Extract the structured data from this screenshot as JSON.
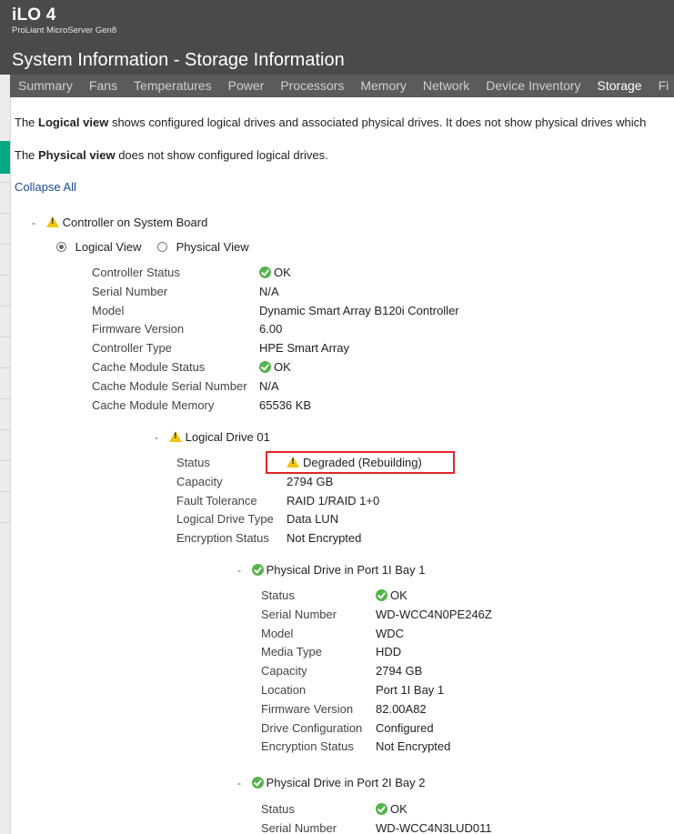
{
  "header": {
    "brand": "iLO 4",
    "server_name": "ProLiant MicroServer Gen8",
    "page_title": "System Information - Storage Information"
  },
  "tabs": [
    {
      "label": "Summary",
      "active": false
    },
    {
      "label": "Fans",
      "active": false
    },
    {
      "label": "Temperatures",
      "active": false
    },
    {
      "label": "Power",
      "active": false
    },
    {
      "label": "Processors",
      "active": false
    },
    {
      "label": "Memory",
      "active": false
    },
    {
      "label": "Network",
      "active": false
    },
    {
      "label": "Device Inventory",
      "active": false
    },
    {
      "label": "Storage",
      "active": true
    },
    {
      "label": "Fi",
      "active": false
    }
  ],
  "intro": {
    "logical_bold": "Logical view",
    "logical_rest": " shows configured logical drives and associated physical drives. It does not show physical drives which",
    "the1": "The ",
    "the2": "The ",
    "physical_bold": "Physical view",
    "physical_rest": " does not show configured logical drives."
  },
  "collapse_all": "Collapse All",
  "controller": {
    "toggle": "-",
    "title": "Controller on System Board",
    "view_logical": "Logical View",
    "view_physical": "Physical View",
    "props": [
      {
        "label": "Controller Status",
        "value": "OK",
        "icon": "ok-icon"
      },
      {
        "label": "Serial Number",
        "value": "N/A"
      },
      {
        "label": "Model",
        "value": "Dynamic Smart Array B120i Controller"
      },
      {
        "label": "Firmware Version",
        "value": "6.00"
      },
      {
        "label": "Controller Type",
        "value": "HPE Smart Array"
      },
      {
        "label": "Cache Module Status",
        "value": "OK",
        "icon": "ok-icon"
      },
      {
        "label": "Cache Module Serial Number",
        "value": "N/A"
      },
      {
        "label": "Cache Module Memory",
        "value": "65536 KB"
      }
    ]
  },
  "logical_drive": {
    "toggle": "-",
    "title": "Logical Drive 01",
    "props": [
      {
        "label": "Status",
        "value": "Degraded (Rebuilding)",
        "icon": "warning-icon"
      },
      {
        "label": "Capacity",
        "value": "2794 GB"
      },
      {
        "label": "Fault Tolerance",
        "value": "RAID 1/RAID 1+0"
      },
      {
        "label": "Logical Drive Type",
        "value": "Data LUN"
      },
      {
        "label": "Encryption Status",
        "value": "Not Encrypted"
      }
    ]
  },
  "physical_drive_1": {
    "toggle": "-",
    "title": "Physical Drive in Port 1I Bay 1",
    "props": [
      {
        "label": "Status",
        "value": "OK",
        "icon": "ok-icon"
      },
      {
        "label": "Serial Number",
        "value": "WD-WCC4N0PE246Z"
      },
      {
        "label": "Model",
        "value": "WDC"
      },
      {
        "label": "Media Type",
        "value": "HDD"
      },
      {
        "label": "Capacity",
        "value": "2794 GB"
      },
      {
        "label": "Location",
        "value": "Port 1I Bay 1"
      },
      {
        "label": "Firmware Version",
        "value": "82.00A82"
      },
      {
        "label": "Drive Configuration",
        "value": "Configured"
      },
      {
        "label": "Encryption Status",
        "value": "Not Encrypted"
      }
    ]
  },
  "physical_drive_2": {
    "toggle": "-",
    "title": "Physical Drive in Port 2I Bay 2",
    "props": [
      {
        "label": "Status",
        "value": "OK",
        "icon": "ok-icon"
      },
      {
        "label": "Serial Number",
        "value": "WD-WCC4N3LUD011"
      }
    ]
  },
  "colors": {
    "header_bg": "#4a4a4a",
    "tabbar_bg": "#5b5b5b",
    "accent_green": "#01a982",
    "ok_green": "#55b34b",
    "warning_yellow": "#f2c40f",
    "highlight_red": "#e0262b",
    "link_blue": "#1a4a8f"
  }
}
